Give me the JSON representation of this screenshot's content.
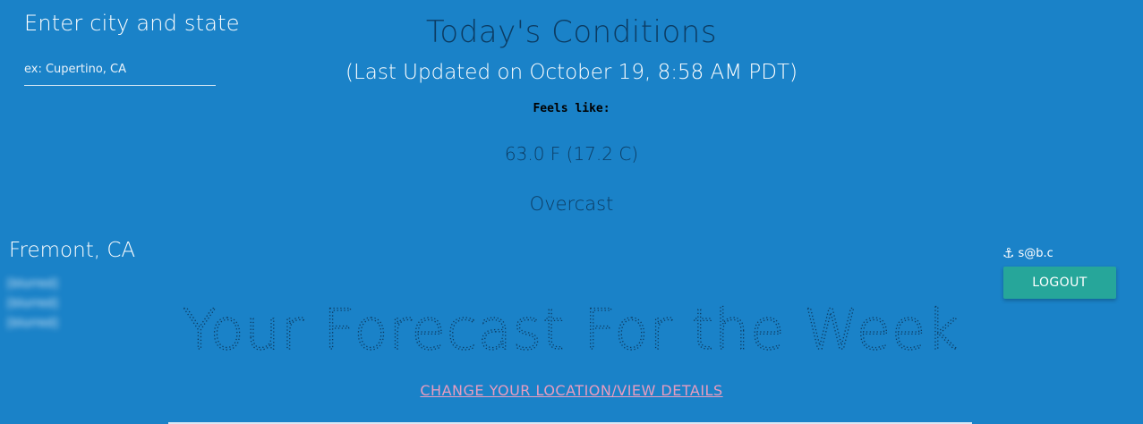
{
  "search": {
    "title": "Enter city and state",
    "placeholder": "ex: Cupertino, CA"
  },
  "conditions": {
    "title": "Today's Conditions",
    "last_updated": "(Last Updated on October 19, 8:58 AM PDT)",
    "feels_like_label": "Feels like:",
    "temperature": "63.0 F (17.2 C)",
    "description": "Overcast"
  },
  "location": {
    "name": "Fremont, CA",
    "details": [
      "[blurred]",
      "[blurred]",
      "[blurred]"
    ]
  },
  "user": {
    "icon": "anchor-icon",
    "email": "s@b.c",
    "logout_label": "LOGOUT"
  },
  "forecast": {
    "heading": "Your Forecast For the Week",
    "change_link": "CHANGE YOUR LOCATION/VIEW DETAILS"
  },
  "colors": {
    "background": "#1a82c8",
    "dark_text": "#0c3c63",
    "logout_button": "#26a69a",
    "link": "#e89cbf"
  }
}
